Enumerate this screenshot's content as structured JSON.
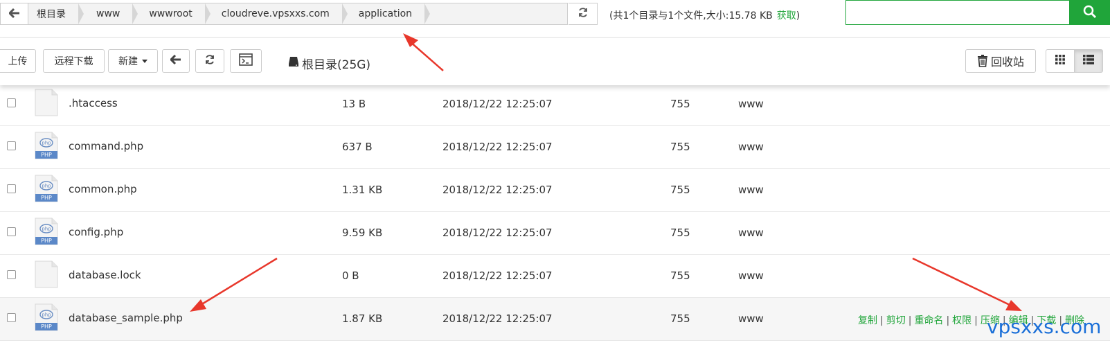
{
  "path": {
    "segments": [
      "根目录",
      "www",
      "wwwroot",
      "cloudreve.vpsxxs.com",
      "application"
    ],
    "info": "(共1个目录与1个文件,大小:15.78 KB",
    "get_label": "获取",
    "info_close": ")",
    "search_placeholder": ""
  },
  "toolbar": {
    "upload": "上传",
    "remote_download": "远程下载",
    "new": "新建",
    "disk": "根目录(25G)",
    "recycle": "回收站"
  },
  "files": [
    {
      "name": ".htaccess",
      "type": "file",
      "size": "13 B",
      "time": "2018/12/22 12:25:07",
      "perm": "755",
      "owner": "www"
    },
    {
      "name": "command.php",
      "type": "php",
      "size": "637 B",
      "time": "2018/12/22 12:25:07",
      "perm": "755",
      "owner": "www"
    },
    {
      "name": "common.php",
      "type": "php",
      "size": "1.31 KB",
      "time": "2018/12/22 12:25:07",
      "perm": "755",
      "owner": "www"
    },
    {
      "name": "config.php",
      "type": "php",
      "size": "9.59 KB",
      "time": "2018/12/22 12:25:07",
      "perm": "755",
      "owner": "www"
    },
    {
      "name": "database.lock",
      "type": "file",
      "size": "0 B",
      "time": "2018/12/22 12:25:07",
      "perm": "755",
      "owner": "www"
    },
    {
      "name": "database_sample.php",
      "type": "php",
      "size": "1.87 KB",
      "time": "2018/12/22 12:25:07",
      "perm": "755",
      "owner": "www"
    }
  ],
  "row_actions": [
    "复制",
    "剪切",
    "重命名",
    "权限",
    "压缩",
    "编辑",
    "下载",
    "删除"
  ],
  "php_badge": "PHP",
  "watermark": "vpsxxs.com",
  "colors": {
    "accent": "#20a53a",
    "arrow": "#e8372b",
    "watermark": "#1a6fd8"
  }
}
